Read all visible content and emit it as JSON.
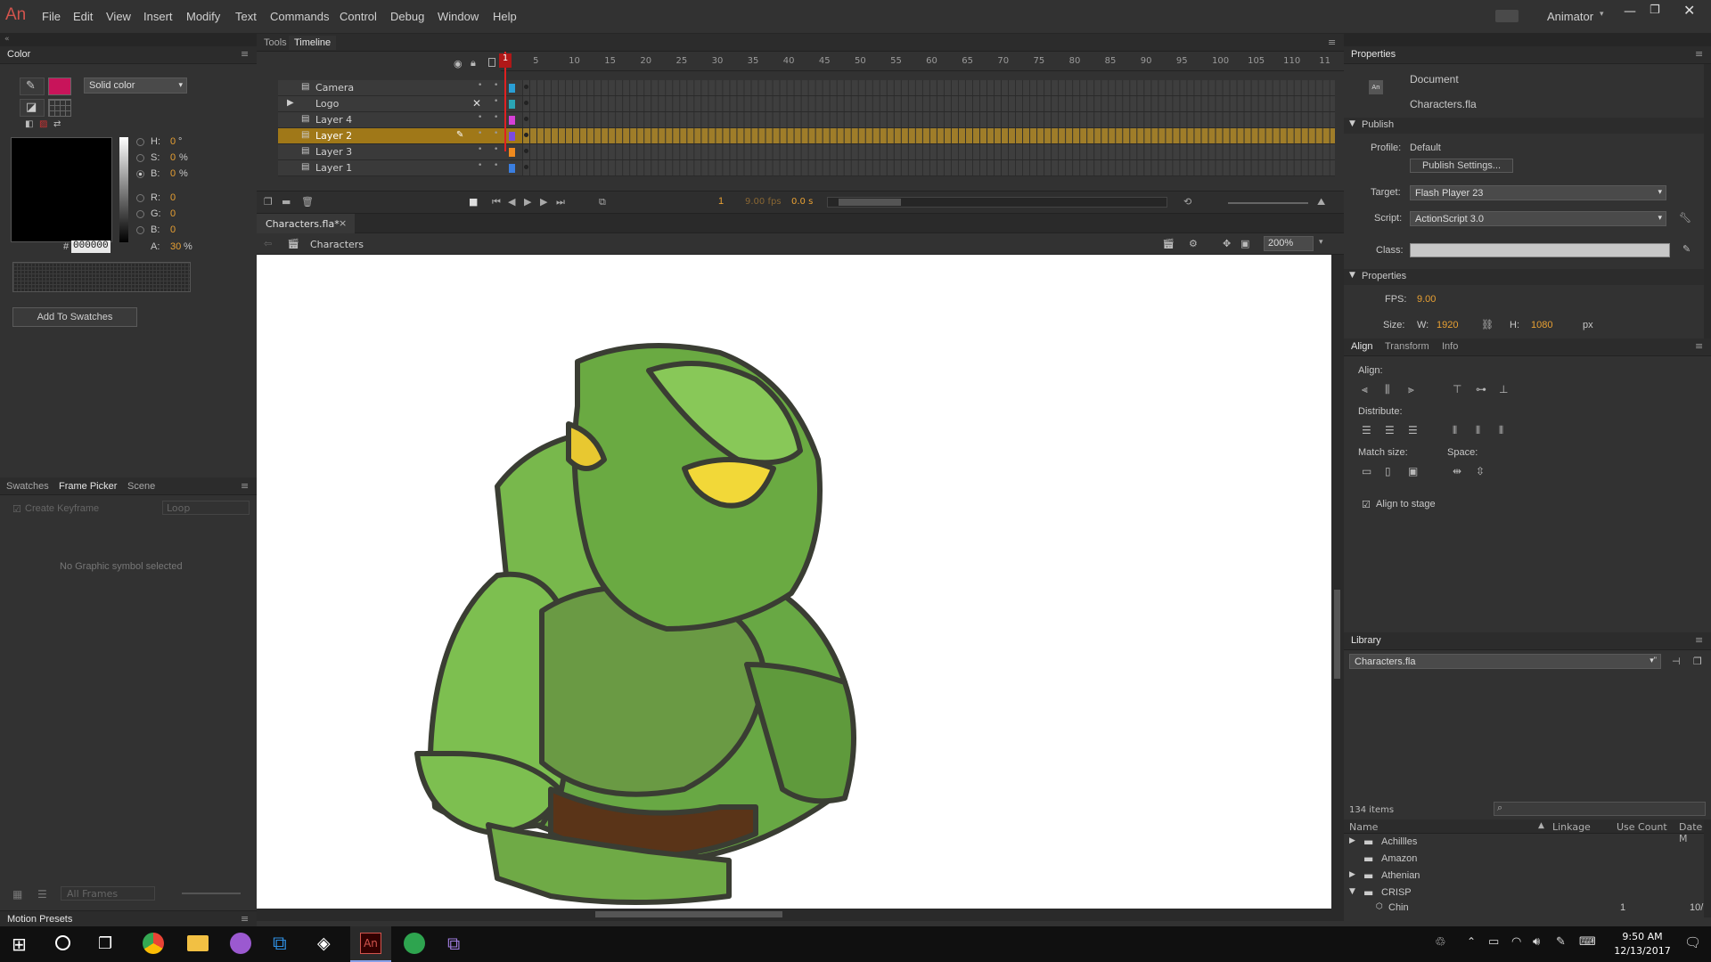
{
  "app": {
    "logo": "An",
    "workspace": "Animator"
  },
  "menu": [
    "File",
    "Edit",
    "View",
    "Insert",
    "Modify",
    "Text",
    "Commands",
    "Control",
    "Debug",
    "Window",
    "Help"
  ],
  "color_panel": {
    "title": "Color",
    "fill_type": "Solid color",
    "hsb": {
      "h_label": "H:",
      "h": "0",
      "h_unit": "°",
      "s_label": "S:",
      "s": "0",
      "s_unit": "%",
      "b_label": "B:",
      "b": "0",
      "b_unit": "%"
    },
    "rgb": {
      "r_label": "R:",
      "r": "0",
      "g_label": "G:",
      "g": "0",
      "b_label": "B:",
      "b": "0"
    },
    "hex_label": "#",
    "hex": "000000",
    "alpha_label": "A:",
    "alpha": "30",
    "alpha_unit": "%",
    "add_swatches": "Add To Swatches",
    "fill_color": "#c8145a"
  },
  "frame_picker": {
    "tabs": [
      "Swatches",
      "Frame Picker",
      "Scene"
    ],
    "create_keyframe": "Create Keyframe",
    "loop": "Loop",
    "empty": "No Graphic symbol selected",
    "all_frames": "All Frames"
  },
  "motion_presets": "Motion Presets",
  "timeline": {
    "tabs": [
      "Tools",
      "Timeline"
    ],
    "ruler": [
      "1",
      "5",
      "10",
      "15",
      "20",
      "25",
      "30",
      "35",
      "40",
      "45",
      "50",
      "55",
      "60",
      "65",
      "70",
      "75",
      "80",
      "85",
      "90",
      "95",
      "100",
      "105",
      "110",
      "11"
    ],
    "layers": [
      {
        "name": "Camera",
        "color": "#2a9fd6"
      },
      {
        "name": "Logo",
        "color": "#2aa5b5"
      },
      {
        "name": "Layer 4",
        "color": "#d640d6"
      },
      {
        "name": "Layer 2",
        "color": "#7a4be0"
      },
      {
        "name": "Layer 3",
        "color": "#ef8a1e"
      },
      {
        "name": "Layer 1",
        "color": "#3a7ee0"
      }
    ],
    "current_frame": "1",
    "fps": "9.00 fps",
    "time": "0.0 s"
  },
  "document": {
    "tab": "Characters.fla*",
    "scene": "Characters",
    "zoom": "200%"
  },
  "properties": {
    "title": "Properties",
    "doc_type": "Document",
    "doc_name": "Characters.fla",
    "publish_head": "Publish",
    "profile_label": "Profile:",
    "profile": "Default",
    "publish_settings": "Publish Settings...",
    "target_label": "Target:",
    "target": "Flash Player 23",
    "script_label": "Script:",
    "script": "ActionScript 3.0",
    "class_label": "Class:",
    "props_head": "Properties",
    "fps_label": "FPS:",
    "fps": "9.00",
    "size_label": "Size:",
    "w_label": "W:",
    "w": "1920",
    "h_label": "H:",
    "h": "1080",
    "unit": "px"
  },
  "align": {
    "tabs": [
      "Align",
      "Transform",
      "Info"
    ],
    "align_label": "Align:",
    "distribute_label": "Distribute:",
    "match_label": "Match size:",
    "space_label": "Space:",
    "to_stage": "Align to stage"
  },
  "library": {
    "title": "Library",
    "file": "Characters.fla",
    "count": "134 items",
    "cols": [
      "Name",
      "Linkage",
      "Use Count",
      "Date M"
    ],
    "items": [
      "Achillles",
      "Amazon",
      "Athenian",
      "CRISP",
      "Chin"
    ],
    "chin_count": "1",
    "chin_date": "10/"
  },
  "taskbar": {
    "time": "9:50 AM",
    "date": "12/13/2017"
  }
}
